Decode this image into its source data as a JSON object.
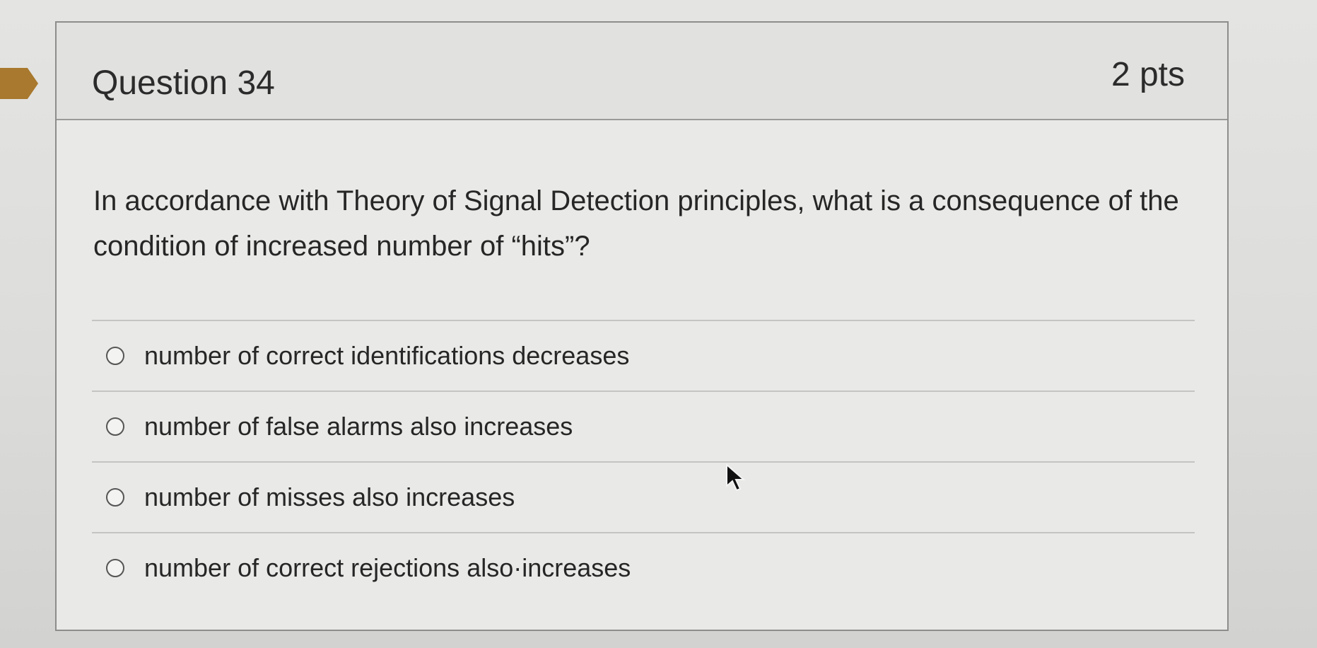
{
  "question": {
    "title": "Question 34",
    "points": "2 pts",
    "text": "In accordance with Theory of Signal Detection principles, what is a consequence of the condition of increased number of “hits”?"
  },
  "answers": [
    {
      "label": "number of correct identifications decreases",
      "selected": false
    },
    {
      "label": "number of false alarms also increases",
      "selected": false
    },
    {
      "label": "number of misses also increases",
      "selected": false
    },
    {
      "label": "number of correct rejections also·increases",
      "selected": false
    }
  ],
  "icons": {
    "flag": "flag-marker-icon",
    "cursor": "mouse-pointer-icon",
    "radio": "radio-button-icon"
  },
  "colors": {
    "flag": "#a8792e",
    "border": "#8d8d8b",
    "text": "#262626"
  }
}
